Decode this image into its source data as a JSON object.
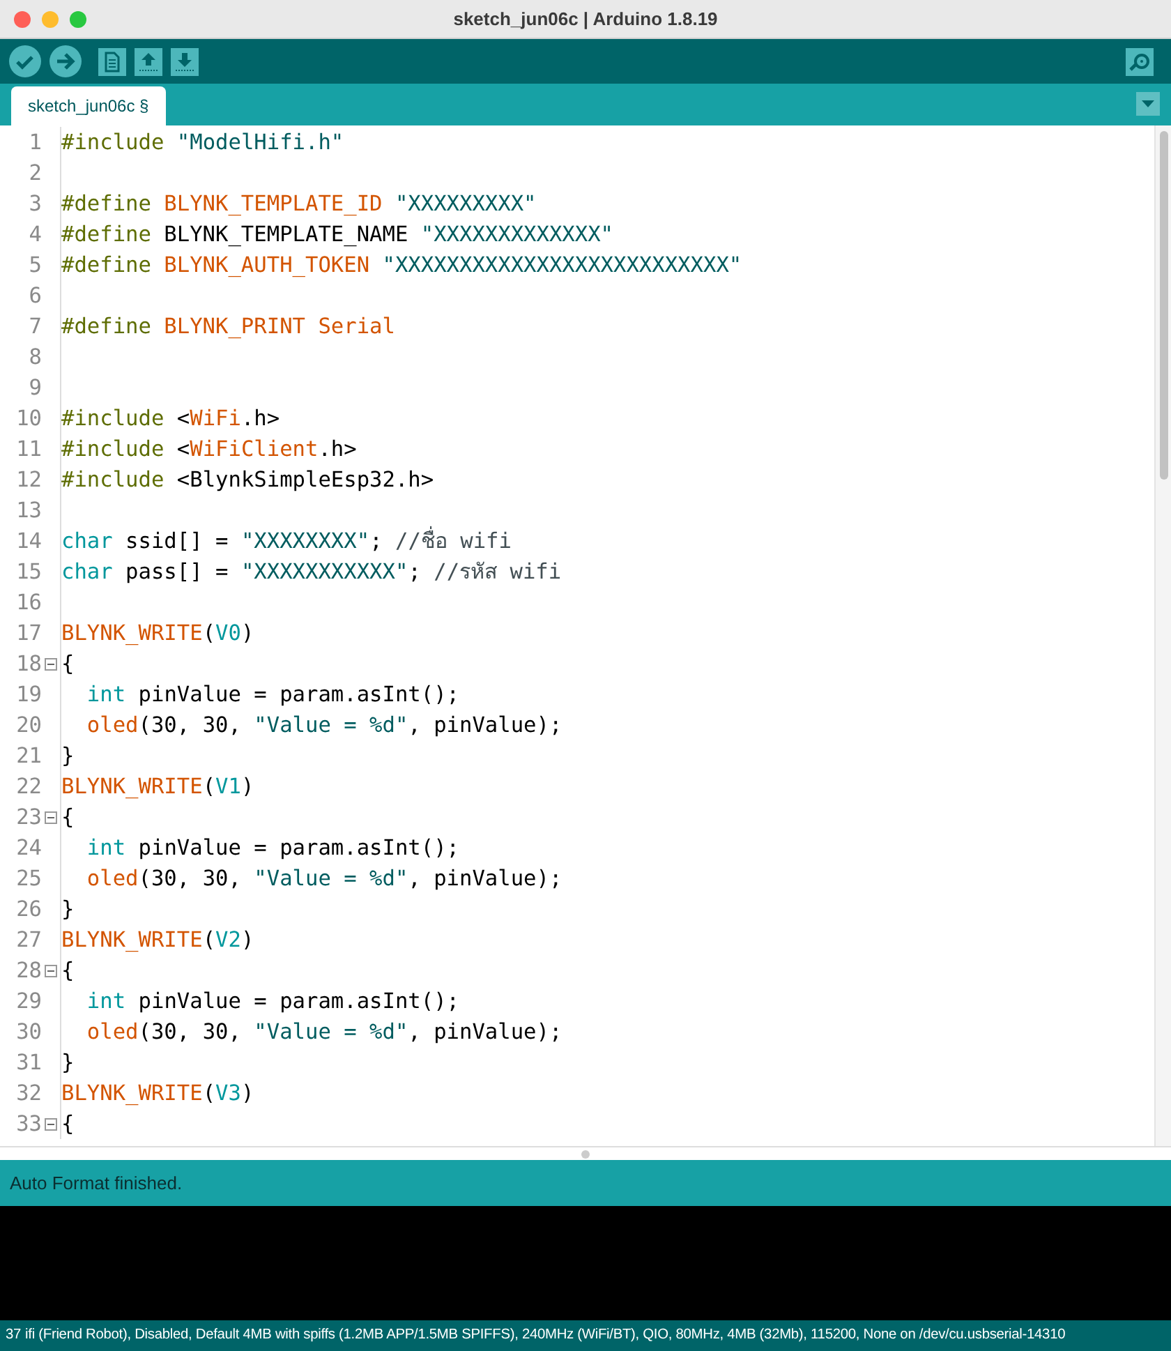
{
  "window": {
    "title": "sketch_jun06c | Arduino 1.8.19"
  },
  "toolbar": {
    "buttons": [
      {
        "kind": "verify"
      },
      {
        "kind": "upload"
      },
      {
        "kind": "new"
      },
      {
        "kind": "open"
      },
      {
        "kind": "save"
      }
    ],
    "right_button": {
      "kind": "serial-monitor"
    }
  },
  "tabs": [
    {
      "label": "sketch_jun06c §",
      "selected": true
    }
  ],
  "editor": {
    "lines": [
      {
        "number": "1",
        "fold": false,
        "tokens": [
          {
            "kind": "directive",
            "text": "#include"
          },
          {
            "kind": "string",
            "text": " \"ModelHifi.h\""
          }
        ]
      },
      {
        "number": "2",
        "fold": false
      },
      {
        "number": "3",
        "fold": false,
        "tokens": [
          {
            "kind": "directive",
            "text": "#define"
          },
          {
            "kind": "keyword",
            "text": " BLYNK_TEMPLATE_ID"
          },
          {
            "kind": "string",
            "text": " \"XXXXXXXXX\""
          }
        ]
      },
      {
        "number": "4",
        "fold": false,
        "tokens": [
          {
            "kind": "directive",
            "text": "#define"
          },
          {
            "kind": "plain",
            "text": " BLYNK_TEMPLATE_NAME "
          },
          {
            "kind": "string",
            "text": "\"XXXXXXXXXXXXX\""
          }
        ]
      },
      {
        "number": "5",
        "fold": false,
        "tokens": [
          {
            "kind": "directive",
            "text": "#define"
          },
          {
            "kind": "keyword",
            "text": " BLYNK_AUTH_TOKEN"
          },
          {
            "kind": "string",
            "text": " \"XXXXXXXXXXXXXXXXXXXXXXXXXX\""
          }
        ]
      },
      {
        "number": "6",
        "fold": false
      },
      {
        "number": "7",
        "fold": false,
        "tokens": [
          {
            "kind": "directive",
            "text": "#define"
          },
          {
            "kind": "keyword",
            "text": " BLYNK_PRINT Serial"
          }
        ]
      },
      {
        "number": "8",
        "fold": false
      },
      {
        "number": "9",
        "fold": false
      },
      {
        "number": "10",
        "fold": false,
        "tokens": [
          {
            "kind": "directive",
            "text": "#include"
          },
          {
            "kind": "plain",
            "text": " <"
          },
          {
            "kind": "keyword",
            "text": "WiFi"
          },
          {
            "kind": "plain",
            "text": ".h>"
          }
        ]
      },
      {
        "number": "11",
        "fold": false,
        "tokens": [
          {
            "kind": "directive",
            "text": "#include"
          },
          {
            "kind": "plain",
            "text": " <"
          },
          {
            "kind": "keyword",
            "text": "WiFiClient"
          },
          {
            "kind": "plain",
            "text": ".h>"
          }
        ]
      },
      {
        "number": "12",
        "fold": false,
        "tokens": [
          {
            "kind": "directive",
            "text": "#include"
          },
          {
            "kind": "plain",
            "text": " <BlynkSimpleEsp32.h>"
          }
        ]
      },
      {
        "number": "13",
        "fold": false
      },
      {
        "number": "14",
        "fold": false,
        "tokens": [
          {
            "kind": "type",
            "text": "char"
          },
          {
            "kind": "plain",
            "text": " ssid[] = "
          },
          {
            "kind": "string",
            "text": "\"XXXXXXXX\""
          },
          {
            "kind": "plain",
            "text": ";"
          },
          {
            "kind": "comment",
            "text": " //ชื่อ wifi"
          }
        ]
      },
      {
        "number": "15",
        "fold": false,
        "tokens": [
          {
            "kind": "type",
            "text": "char"
          },
          {
            "kind": "plain",
            "text": " pass[] = "
          },
          {
            "kind": "string",
            "text": "\"XXXXXXXXXXX\""
          },
          {
            "kind": "plain",
            "text": ";"
          },
          {
            "kind": "comment",
            "text": " //รหัส wifi"
          }
        ]
      },
      {
        "number": "16",
        "fold": false
      },
      {
        "number": "17",
        "fold": false,
        "tokens": [
          {
            "kind": "keyword",
            "text": "BLYNK_WRITE"
          },
          {
            "kind": "plain",
            "text": "("
          },
          {
            "kind": "type",
            "text": "V0"
          },
          {
            "kind": "plain",
            "text": ")"
          }
        ]
      },
      {
        "number": "18",
        "fold": true,
        "tokens": [
          {
            "kind": "plain",
            "text": "{"
          }
        ]
      },
      {
        "number": "19",
        "fold": false,
        "tokens": [
          {
            "kind": "type",
            "text": "  int"
          },
          {
            "kind": "plain",
            "text": " pinValue = param.asInt();"
          }
        ]
      },
      {
        "number": "20",
        "fold": false,
        "tokens": [
          {
            "kind": "keyword",
            "text": "  oled"
          },
          {
            "kind": "plain",
            "text": "(30, 30, "
          },
          {
            "kind": "string",
            "text": "\"Value = %d\""
          },
          {
            "kind": "plain",
            "text": ", pinValue);"
          }
        ]
      },
      {
        "number": "21",
        "fold": false,
        "tokens": [
          {
            "kind": "plain",
            "text": "}"
          }
        ]
      },
      {
        "number": "22",
        "fold": false,
        "tokens": [
          {
            "kind": "keyword",
            "text": "BLYNK_WRITE"
          },
          {
            "kind": "plain",
            "text": "("
          },
          {
            "kind": "type",
            "text": "V1"
          },
          {
            "kind": "plain",
            "text": ")"
          }
        ]
      },
      {
        "number": "23",
        "fold": true,
        "tokens": [
          {
            "kind": "plain",
            "text": "{"
          }
        ]
      },
      {
        "number": "24",
        "fold": false,
        "tokens": [
          {
            "kind": "type",
            "text": "  int"
          },
          {
            "kind": "plain",
            "text": " pinValue = param.asInt();"
          }
        ]
      },
      {
        "number": "25",
        "fold": false,
        "tokens": [
          {
            "kind": "keyword",
            "text": "  oled"
          },
          {
            "kind": "plain",
            "text": "(30, 30, "
          },
          {
            "kind": "string",
            "text": "\"Value = %d\""
          },
          {
            "kind": "plain",
            "text": ", pinValue);"
          }
        ]
      },
      {
        "number": "26",
        "fold": false,
        "tokens": [
          {
            "kind": "plain",
            "text": "}"
          }
        ]
      },
      {
        "number": "27",
        "fold": false,
        "tokens": [
          {
            "kind": "keyword",
            "text": "BLYNK_WRITE"
          },
          {
            "kind": "plain",
            "text": "("
          },
          {
            "kind": "type",
            "text": "V2"
          },
          {
            "kind": "plain",
            "text": ")"
          }
        ]
      },
      {
        "number": "28",
        "fold": true,
        "tokens": [
          {
            "kind": "plain",
            "text": "{"
          }
        ]
      },
      {
        "number": "29",
        "fold": false,
        "tokens": [
          {
            "kind": "type",
            "text": "  int"
          },
          {
            "kind": "plain",
            "text": " pinValue = param.asInt();"
          }
        ]
      },
      {
        "number": "30",
        "fold": false,
        "tokens": [
          {
            "kind": "keyword",
            "text": "  oled"
          },
          {
            "kind": "plain",
            "text": "(30, 30, "
          },
          {
            "kind": "string",
            "text": "\"Value = %d\""
          },
          {
            "kind": "plain",
            "text": ", pinValue);"
          }
        ]
      },
      {
        "number": "31",
        "fold": false,
        "tokens": [
          {
            "kind": "plain",
            "text": "}"
          }
        ]
      },
      {
        "number": "32",
        "fold": false,
        "tokens": [
          {
            "kind": "keyword",
            "text": "BLYNK_WRITE"
          },
          {
            "kind": "plain",
            "text": "("
          },
          {
            "kind": "type",
            "text": "V3"
          },
          {
            "kind": "plain",
            "text": ")"
          }
        ]
      },
      {
        "number": "33",
        "fold": true,
        "tokens": [
          {
            "kind": "plain",
            "text": "{"
          }
        ]
      }
    ]
  },
  "message": "Auto Format finished.",
  "status_bar": {
    "line": "37",
    "text": "ifi (Friend Robot), Disabled, Default 4MB with spiffs (1.2MB APP/1.5MB SPIFFS), 240MHz (WiFi/BT), QIO, 80MHz, 4MB (32Mb), 115200, None on /dev/cu.usbserial-14310"
  }
}
